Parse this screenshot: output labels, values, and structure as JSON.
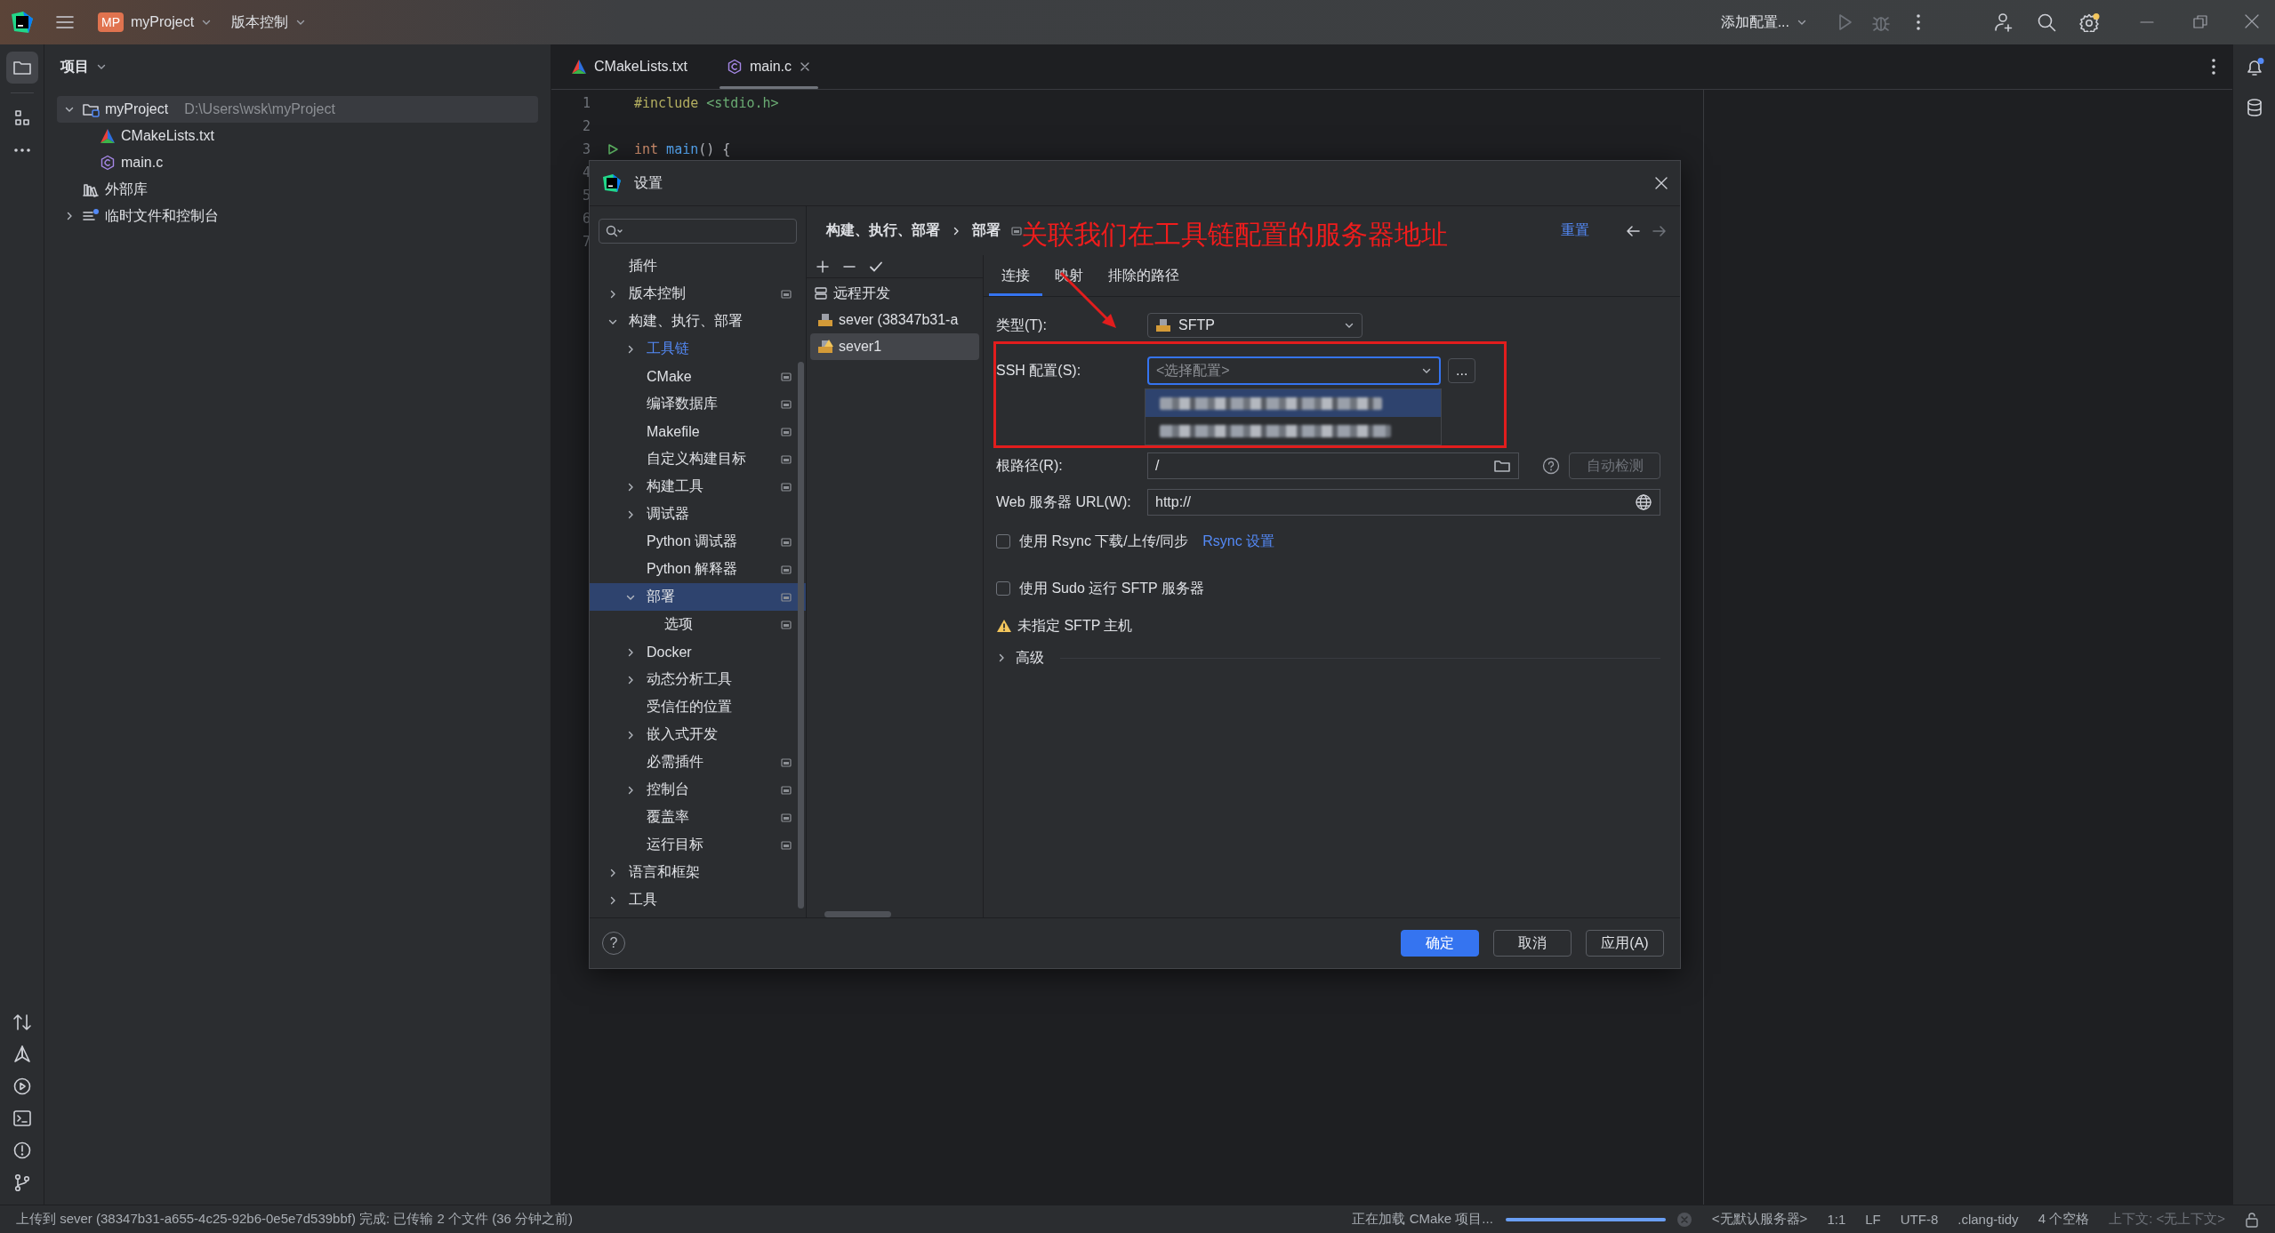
{
  "title_bar": {
    "project_badge": "MP",
    "project": "myProject",
    "vcs": "版本控制",
    "run_config": "添加配置..."
  },
  "left_tools": [
    {
      "selected": true
    },
    {
      "selected": false
    },
    {
      "selected": false
    }
  ],
  "project_panel": {
    "title": "项目",
    "tree": [
      {
        "label": "myProject",
        "path": "D:\\Users\\wsk\\myProject",
        "kind": "module",
        "expanded": true,
        "selected": true,
        "children": [
          {
            "label": "CMakeLists.txt",
            "kind": "cmake",
            "selected": false
          },
          {
            "label": "main.c",
            "kind": "c",
            "selected": false
          }
        ]
      },
      {
        "label": "外部库",
        "kind": "library",
        "selected": false
      },
      {
        "label": "临时文件和控制台",
        "kind": "scratch",
        "expanded": false,
        "selected": false
      }
    ]
  },
  "editor": {
    "tabs": [
      {
        "label": "CMakeLists.txt",
        "kind": "cmake",
        "selected": false
      },
      {
        "label": "main.c",
        "kind": "c",
        "selected": true
      }
    ],
    "lines": [
      {
        "number": "1",
        "code": [
          {
            "text": "#include",
            "kind": "directive"
          },
          {
            "text": " <stdio.h>",
            "kind": "string"
          }
        ]
      },
      {
        "number": "2"
      },
      {
        "number": "3",
        "run_marker": true,
        "code": [
          {
            "text": "int",
            "kind": "keyword"
          },
          {
            "text": " main",
            "kind": "function"
          },
          {
            "text": "() {",
            "kind": "plain"
          }
        ]
      },
      {
        "number": "4"
      },
      {
        "number": "5"
      },
      {
        "number": "6"
      },
      {
        "number": "7"
      }
    ]
  },
  "notifications": {
    "unread": true
  },
  "dialog": {
    "title": "设置",
    "tree": [
      {
        "label": "插件",
        "selected": false
      },
      {
        "label": "版本控制",
        "expanded": false,
        "project_level": true,
        "selected": false
      },
      {
        "label": "构建、执行、部署",
        "expanded": true,
        "selected": false,
        "children": [
          {
            "label": "工具链",
            "expanded": false,
            "modified": true,
            "selected": false
          },
          {
            "label": "CMake",
            "project_level": true,
            "selected": false
          },
          {
            "label": "编译数据库",
            "project_level": true,
            "selected": false
          },
          {
            "label": "Makefile",
            "project_level": true,
            "selected": false
          },
          {
            "label": "自定义构建目标",
            "project_level": true,
            "selected": false
          },
          {
            "label": "构建工具",
            "expanded": false,
            "project_level": true,
            "selected": false
          },
          {
            "label": "调试器",
            "expanded": false,
            "selected": false
          },
          {
            "label": "Python 调试器",
            "project_level": true,
            "selected": false
          },
          {
            "label": "Python 解释器",
            "project_level": true,
            "selected": false
          },
          {
            "label": "部署",
            "expanded": true,
            "project_level": true,
            "selected": true,
            "children": [
              {
                "label": "选项",
                "project_level": true,
                "selected": false
              }
            ]
          },
          {
            "label": "Docker",
            "expanded": false,
            "selected": false
          },
          {
            "label": "动态分析工具",
            "expanded": false,
            "selected": false
          },
          {
            "label": "受信任的位置",
            "selected": false
          },
          {
            "label": "嵌入式开发",
            "expanded": false,
            "selected": false
          },
          {
            "label": "必需插件",
            "project_level": true,
            "selected": false
          },
          {
            "label": "控制台",
            "expanded": false,
            "project_level": true,
            "selected": false
          },
          {
            "label": "覆盖率",
            "project_level": true,
            "selected": false
          },
          {
            "label": "运行目标",
            "project_level": true,
            "selected": false
          }
        ]
      },
      {
        "label": "语言和框架",
        "expanded": false,
        "selected": false
      },
      {
        "label": "工具",
        "expanded": false,
        "selected": false
      }
    ],
    "breadcrumb": [
      "构建、执行、部署",
      "部署"
    ],
    "annotation": "关联我们在工具链配置的服务器地址",
    "reset": "重置",
    "servers": {
      "group": "远程开发",
      "items": [
        {
          "label": "sever (38347b31-a",
          "warning": false,
          "selected": false
        },
        {
          "label": "sever1",
          "warning": true,
          "selected": true
        }
      ]
    },
    "tabs": [
      {
        "label": "连接",
        "selected": true
      },
      {
        "label": "映射",
        "selected": false
      },
      {
        "label": "排除的路径",
        "selected": false
      }
    ],
    "connection": {
      "type_label": "类型(T):",
      "type_value": "SFTP",
      "ssh_label": "SSH 配置(S):",
      "ssh_placeholder": "<选择配置>",
      "ssh_more": "...",
      "ssh_options": [
        {
          "selected": true
        },
        {
          "selected": false
        }
      ],
      "root_label": "根路径(R):",
      "root_value": "/",
      "autodetect": {
        "label": "自动检测",
        "disabled": true
      },
      "url_label": "Web 服务器 URL(W):",
      "url_value": "http://",
      "options": [
        {
          "label": "使用 Rsync 下载/上传/同步",
          "checked": false,
          "link": "Rsync 设置"
        },
        {
          "label": "使用 Sudo 运行 SFTP 服务器",
          "checked": false
        }
      ],
      "warning": "未指定 SFTP 主机",
      "advanced": {
        "label": "高级",
        "expanded": false
      }
    },
    "help": "?",
    "buttons": [
      {
        "label": "确定",
        "primary": true
      },
      {
        "label": "取消",
        "primary": false
      },
      {
        "label": "应用(A)",
        "primary": false
      }
    ]
  },
  "status_bar": {
    "message": "上传到 sever (38347b31-a655-4c25-92b6-0e5e7d539bbf) 完成: 已传输 2 个文件 (36 分钟之前)",
    "task": "正在加载 CMake 项目...",
    "progress": {
      "level": 1
    },
    "items": [
      "<无默认服务器>",
      "1:1",
      "LF",
      "UTF-8",
      ".clang-tidy",
      "4 个空格"
    ],
    "context": "上下文: <无上下文>"
  }
}
